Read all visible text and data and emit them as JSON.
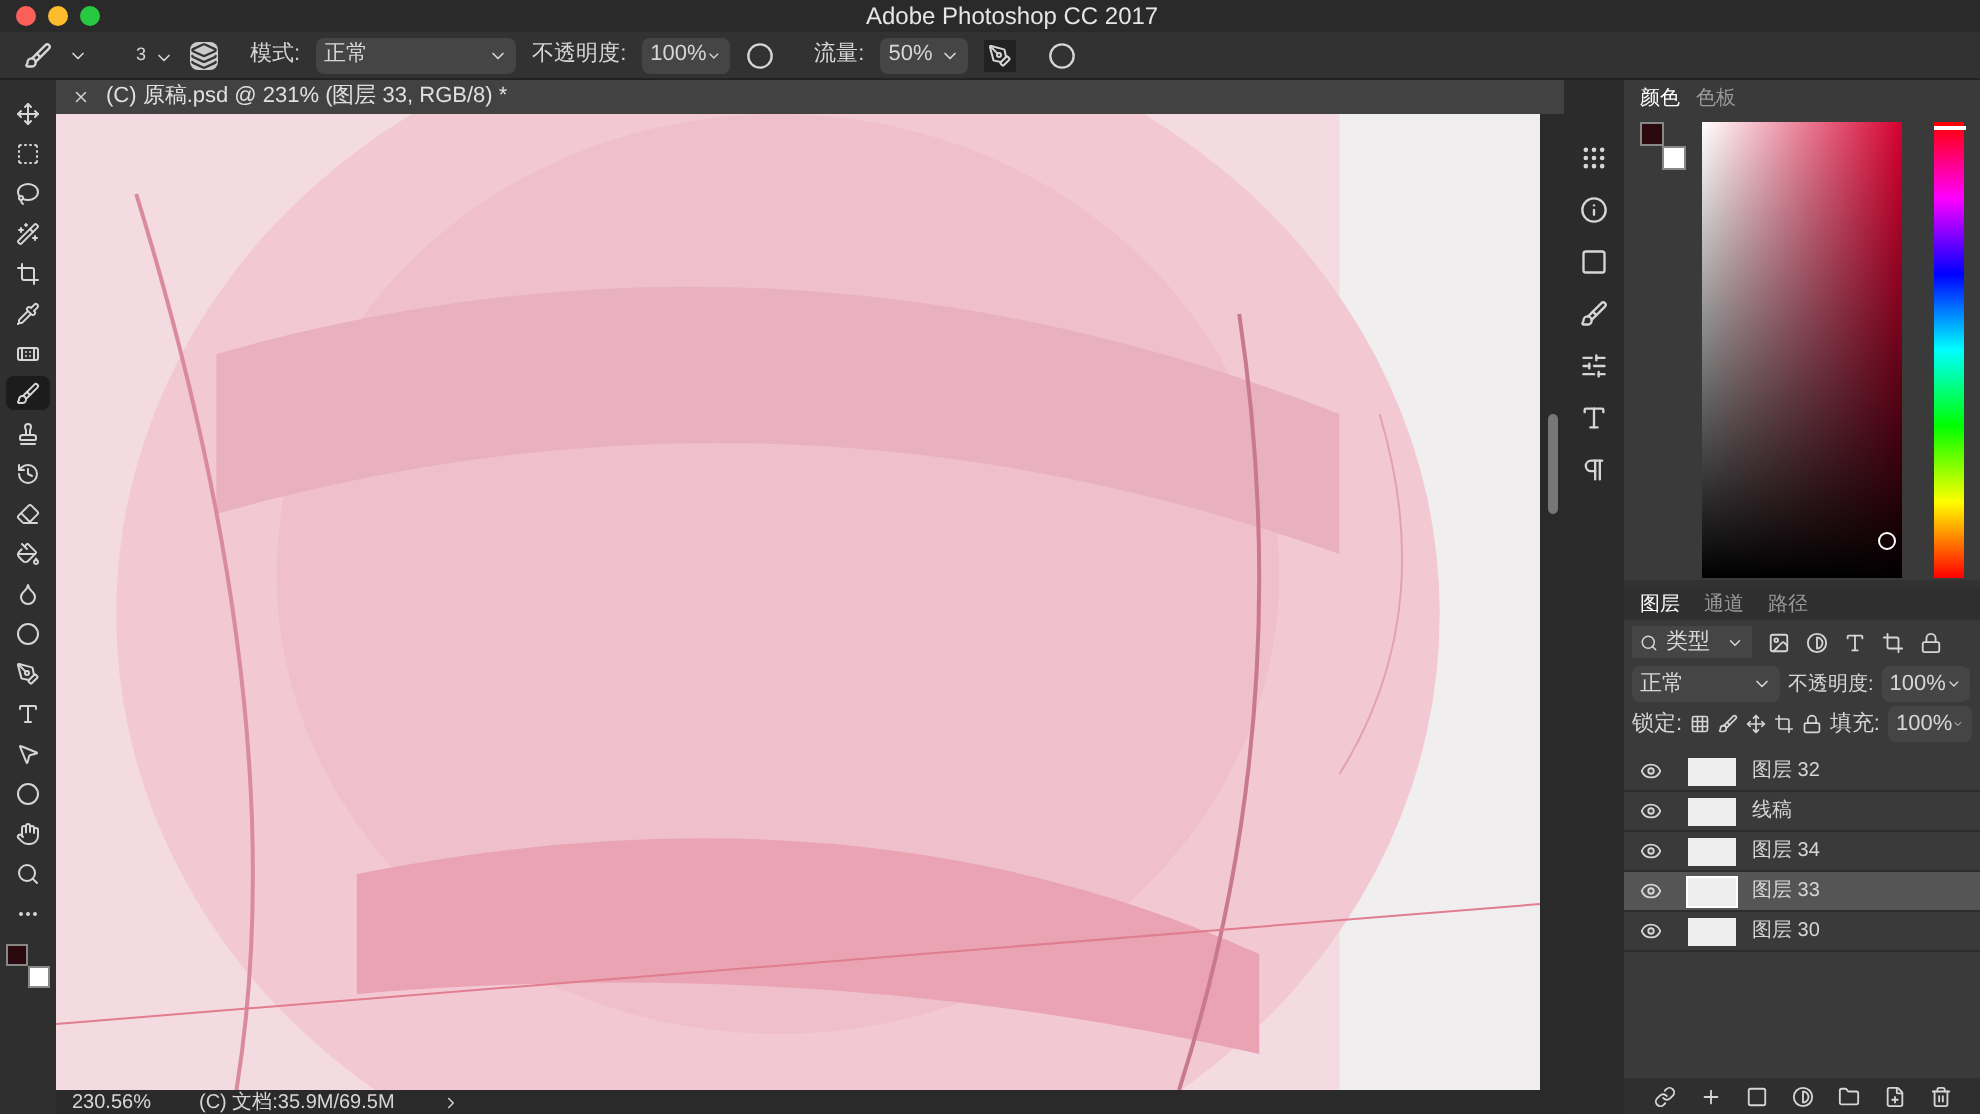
{
  "window": {
    "title": "Adobe Photoshop CC 2017"
  },
  "options_bar": {
    "brush_size": "3",
    "mode_label": "模式:",
    "mode_value": "正常",
    "opacity_label": "不透明度:",
    "opacity_value": "100%",
    "flow_label": "流量:",
    "flow_value": "50%"
  },
  "document_tab": {
    "title": "(C) 原稿.psd @ 231% (图层 33, RGB/8) *"
  },
  "tools": [
    {
      "selected": false
    },
    {
      "selected": false
    },
    {
      "selected": false
    },
    {
      "selected": false
    },
    {
      "selected": false
    },
    {
      "selected": false
    },
    {
      "selected": false
    },
    {
      "selected": true
    },
    {
      "selected": false
    },
    {
      "selected": false
    },
    {
      "selected": false
    },
    {
      "selected": false
    },
    {
      "selected": false
    },
    {
      "selected": false
    },
    {
      "selected": false
    },
    {
      "selected": false
    },
    {
      "selected": false
    },
    {
      "selected": false
    },
    {
      "selected": false
    },
    {
      "selected": false
    },
    {
      "selected": false
    }
  ],
  "status_bar": {
    "zoom": "230.56%",
    "document": "(C) 文档:35.9M/69.5M"
  },
  "color_panel": {
    "hue": {
      "level": 0.01
    },
    "tabs": [
      {
        "label": "颜色",
        "selected": true
      },
      {
        "label": "色板",
        "selected": false
      }
    ]
  },
  "layers_panel": {
    "tabs": [
      {
        "label": "图层",
        "selected": true
      },
      {
        "label": "通道",
        "selected": false
      },
      {
        "label": "路径",
        "selected": false
      }
    ],
    "filter": "类型",
    "blend_mode": "正常",
    "opacity_label": "不透明度:",
    "opacity_value": "100%",
    "lock_label": "锁定:",
    "fill_label": "填充:",
    "fill_value": "100%",
    "layers": [
      {
        "name": "图层 32",
        "visible": true,
        "selected": false
      },
      {
        "name": "线稿",
        "visible": true,
        "selected": false
      },
      {
        "name": "图层 34",
        "visible": true,
        "selected": false
      },
      {
        "name": "图层 33",
        "visible": true,
        "selected": true
      },
      {
        "name": "图层 30",
        "visible": true,
        "selected": false
      }
    ]
  }
}
